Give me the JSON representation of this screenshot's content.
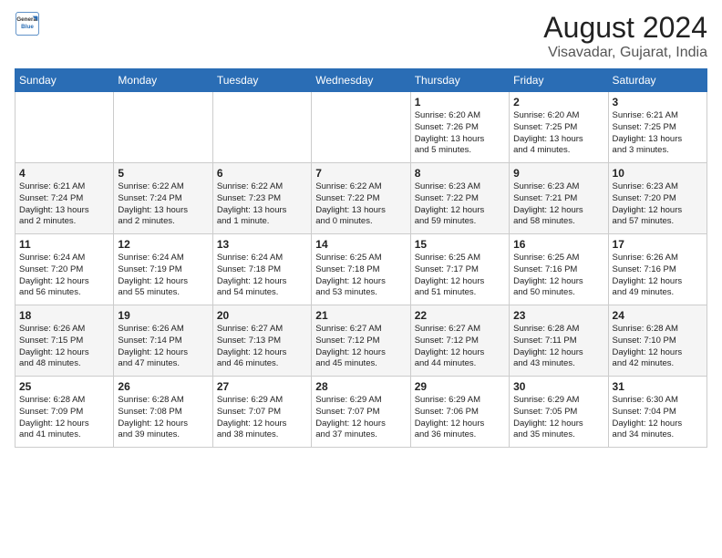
{
  "logo": {
    "line1": "General",
    "line2": "Blue"
  },
  "title": "August 2024",
  "subtitle": "Visavadar, Gujarat, India",
  "days_of_week": [
    "Sunday",
    "Monday",
    "Tuesday",
    "Wednesday",
    "Thursday",
    "Friday",
    "Saturday"
  ],
  "weeks": [
    [
      {
        "day": "",
        "info": ""
      },
      {
        "day": "",
        "info": ""
      },
      {
        "day": "",
        "info": ""
      },
      {
        "day": "",
        "info": ""
      },
      {
        "day": "1",
        "info": "Sunrise: 6:20 AM\nSunset: 7:26 PM\nDaylight: 13 hours\nand 5 minutes."
      },
      {
        "day": "2",
        "info": "Sunrise: 6:20 AM\nSunset: 7:25 PM\nDaylight: 13 hours\nand 4 minutes."
      },
      {
        "day": "3",
        "info": "Sunrise: 6:21 AM\nSunset: 7:25 PM\nDaylight: 13 hours\nand 3 minutes."
      }
    ],
    [
      {
        "day": "4",
        "info": "Sunrise: 6:21 AM\nSunset: 7:24 PM\nDaylight: 13 hours\nand 2 minutes."
      },
      {
        "day": "5",
        "info": "Sunrise: 6:22 AM\nSunset: 7:24 PM\nDaylight: 13 hours\nand 2 minutes."
      },
      {
        "day": "6",
        "info": "Sunrise: 6:22 AM\nSunset: 7:23 PM\nDaylight: 13 hours\nand 1 minute."
      },
      {
        "day": "7",
        "info": "Sunrise: 6:22 AM\nSunset: 7:22 PM\nDaylight: 13 hours\nand 0 minutes."
      },
      {
        "day": "8",
        "info": "Sunrise: 6:23 AM\nSunset: 7:22 PM\nDaylight: 12 hours\nand 59 minutes."
      },
      {
        "day": "9",
        "info": "Sunrise: 6:23 AM\nSunset: 7:21 PM\nDaylight: 12 hours\nand 58 minutes."
      },
      {
        "day": "10",
        "info": "Sunrise: 6:23 AM\nSunset: 7:20 PM\nDaylight: 12 hours\nand 57 minutes."
      }
    ],
    [
      {
        "day": "11",
        "info": "Sunrise: 6:24 AM\nSunset: 7:20 PM\nDaylight: 12 hours\nand 56 minutes."
      },
      {
        "day": "12",
        "info": "Sunrise: 6:24 AM\nSunset: 7:19 PM\nDaylight: 12 hours\nand 55 minutes."
      },
      {
        "day": "13",
        "info": "Sunrise: 6:24 AM\nSunset: 7:18 PM\nDaylight: 12 hours\nand 54 minutes."
      },
      {
        "day": "14",
        "info": "Sunrise: 6:25 AM\nSunset: 7:18 PM\nDaylight: 12 hours\nand 53 minutes."
      },
      {
        "day": "15",
        "info": "Sunrise: 6:25 AM\nSunset: 7:17 PM\nDaylight: 12 hours\nand 51 minutes."
      },
      {
        "day": "16",
        "info": "Sunrise: 6:25 AM\nSunset: 7:16 PM\nDaylight: 12 hours\nand 50 minutes."
      },
      {
        "day": "17",
        "info": "Sunrise: 6:26 AM\nSunset: 7:16 PM\nDaylight: 12 hours\nand 49 minutes."
      }
    ],
    [
      {
        "day": "18",
        "info": "Sunrise: 6:26 AM\nSunset: 7:15 PM\nDaylight: 12 hours\nand 48 minutes."
      },
      {
        "day": "19",
        "info": "Sunrise: 6:26 AM\nSunset: 7:14 PM\nDaylight: 12 hours\nand 47 minutes."
      },
      {
        "day": "20",
        "info": "Sunrise: 6:27 AM\nSunset: 7:13 PM\nDaylight: 12 hours\nand 46 minutes."
      },
      {
        "day": "21",
        "info": "Sunrise: 6:27 AM\nSunset: 7:12 PM\nDaylight: 12 hours\nand 45 minutes."
      },
      {
        "day": "22",
        "info": "Sunrise: 6:27 AM\nSunset: 7:12 PM\nDaylight: 12 hours\nand 44 minutes."
      },
      {
        "day": "23",
        "info": "Sunrise: 6:28 AM\nSunset: 7:11 PM\nDaylight: 12 hours\nand 43 minutes."
      },
      {
        "day": "24",
        "info": "Sunrise: 6:28 AM\nSunset: 7:10 PM\nDaylight: 12 hours\nand 42 minutes."
      }
    ],
    [
      {
        "day": "25",
        "info": "Sunrise: 6:28 AM\nSunset: 7:09 PM\nDaylight: 12 hours\nand 41 minutes."
      },
      {
        "day": "26",
        "info": "Sunrise: 6:28 AM\nSunset: 7:08 PM\nDaylight: 12 hours\nand 39 minutes."
      },
      {
        "day": "27",
        "info": "Sunrise: 6:29 AM\nSunset: 7:07 PM\nDaylight: 12 hours\nand 38 minutes."
      },
      {
        "day": "28",
        "info": "Sunrise: 6:29 AM\nSunset: 7:07 PM\nDaylight: 12 hours\nand 37 minutes."
      },
      {
        "day": "29",
        "info": "Sunrise: 6:29 AM\nSunset: 7:06 PM\nDaylight: 12 hours\nand 36 minutes."
      },
      {
        "day": "30",
        "info": "Sunrise: 6:29 AM\nSunset: 7:05 PM\nDaylight: 12 hours\nand 35 minutes."
      },
      {
        "day": "31",
        "info": "Sunrise: 6:30 AM\nSunset: 7:04 PM\nDaylight: 12 hours\nand 34 minutes."
      }
    ]
  ]
}
